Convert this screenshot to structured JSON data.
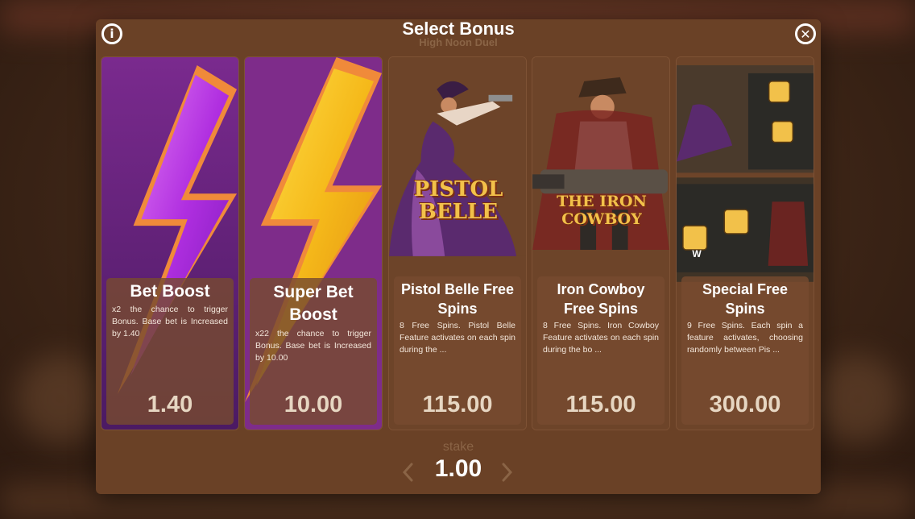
{
  "header": {
    "title": "Select Bonus",
    "subtitle": "High Noon Duel",
    "info_icon": "info-icon",
    "close_icon": "close-icon"
  },
  "cards": [
    {
      "title": "Bet Boost",
      "description": "x2 the chance to trigger Bonus. Base bet is Increased by 1.40",
      "price": "1.40",
      "art": "purple-lightning"
    },
    {
      "title": "Super Bet Boost",
      "description": "x22 the chance to trigger Bonus. Base bet is Increased by 10.00",
      "price": "10.00",
      "art": "gold-lightning"
    },
    {
      "title": "Pistol Belle Free Spins",
      "description": "8 Free Spins. Pistol Belle Feature activates on each spin during the ...",
      "price": "115.00",
      "art": "pistol-belle",
      "art_text": "PISTOL BELLE"
    },
    {
      "title": "Iron Cowboy Free Spins",
      "description": "8 Free Spins. Iron Cowboy Feature activates on each spin during the bo ...",
      "price": "115.00",
      "art": "iron-cowboy",
      "art_text": "THE IRON COWBOY"
    },
    {
      "title": "Special Free Spins",
      "description": "9 Free Spins. Each spin a feature activates, choosing randomly between Pis ...",
      "price": "300.00",
      "art": "special-collage",
      "art_text": "W"
    }
  ],
  "stake": {
    "label": "stake",
    "value": "1.00"
  },
  "colors": {
    "modal": "#6a4126",
    "price": "#e6d6c2",
    "purple": "#a72bd6",
    "gold": "#f5b91a"
  }
}
